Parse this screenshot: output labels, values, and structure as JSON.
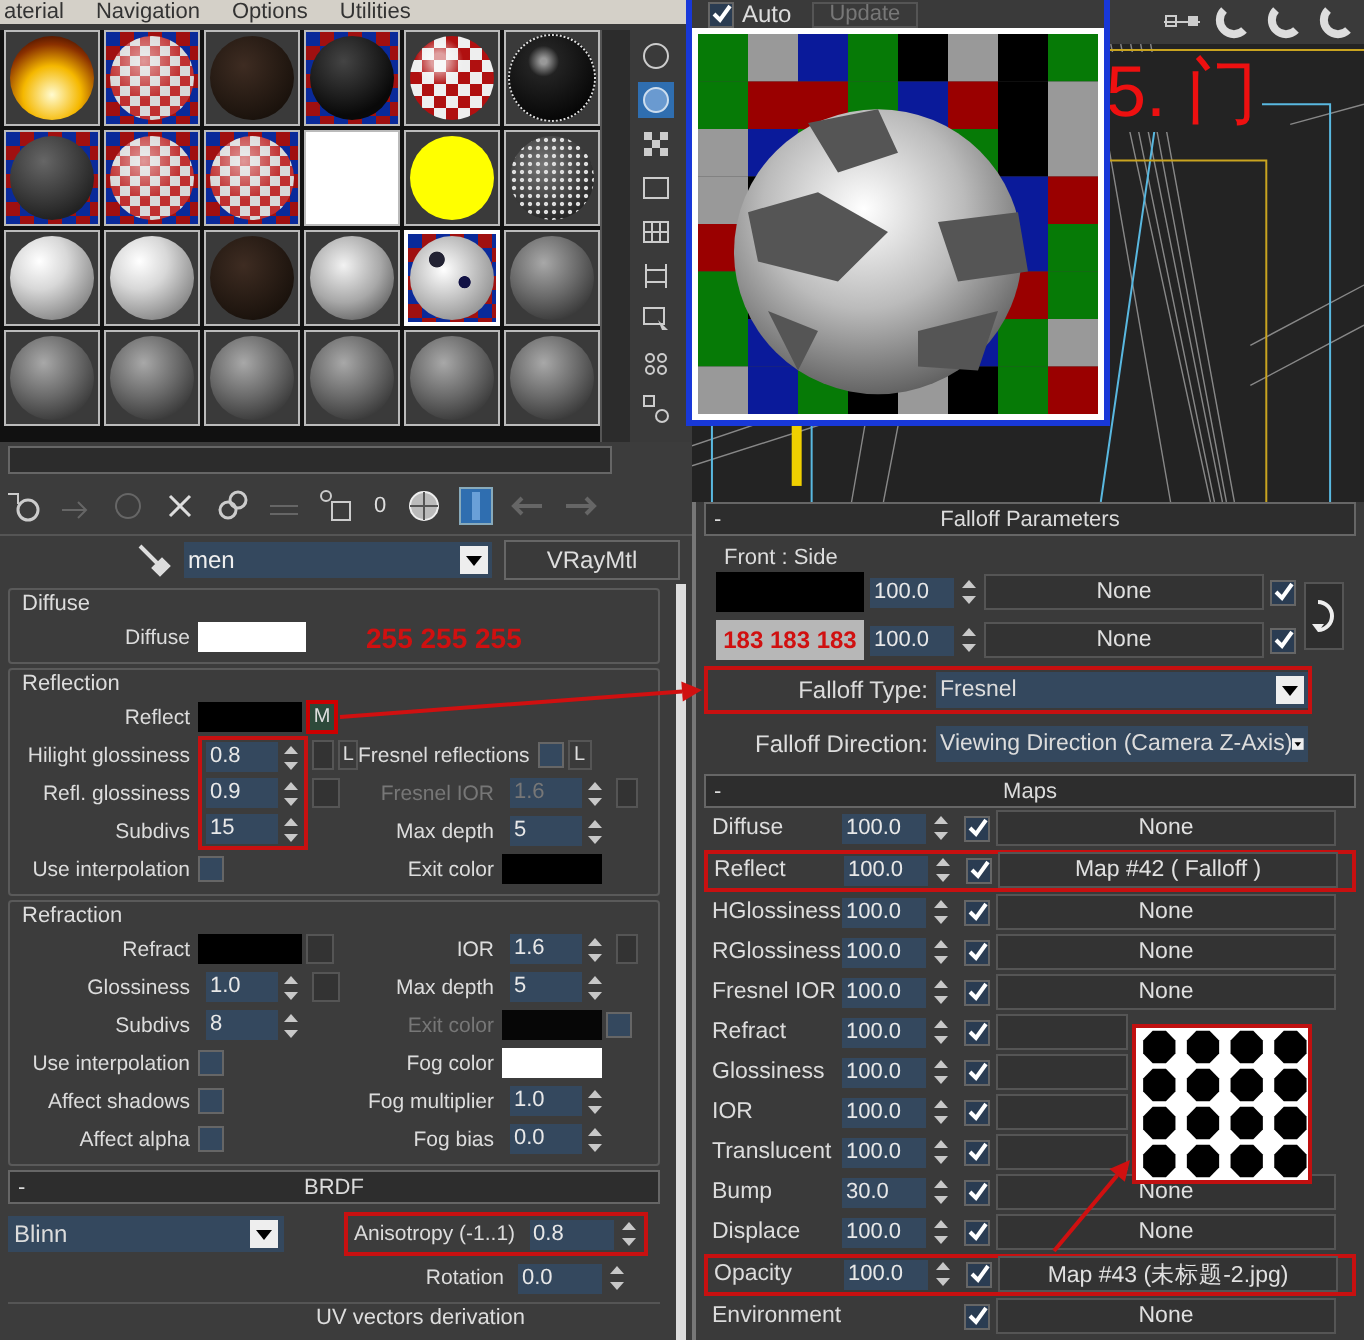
{
  "menu": [
    "aterial",
    "Navigation",
    "Options",
    "Utilities"
  ],
  "sample_slots": [
    {
      "kind": "flame",
      "selected": false
    },
    {
      "kind": "checker",
      "selected": false
    },
    {
      "kind": "brown",
      "selected": false
    },
    {
      "kind": "checker-dark",
      "selected": false
    },
    {
      "kind": "red-checker",
      "selected": false
    },
    {
      "kind": "black",
      "selected": false
    },
    {
      "kind": "checker-gray",
      "selected": false
    },
    {
      "kind": "checker",
      "selected": false
    },
    {
      "kind": "checker",
      "selected": false
    },
    {
      "kind": "white",
      "selected": false
    },
    {
      "kind": "yellow",
      "selected": false
    },
    {
      "kind": "speckled",
      "selected": false
    },
    {
      "kind": "pearl",
      "selected": false
    },
    {
      "kind": "pearl",
      "selected": false
    },
    {
      "kind": "brown",
      "selected": false
    },
    {
      "kind": "silver",
      "selected": false
    },
    {
      "kind": "perforated",
      "selected": true
    },
    {
      "kind": "gray",
      "selected": false
    },
    {
      "kind": "gray",
      "selected": false
    },
    {
      "kind": "gray",
      "selected": false
    },
    {
      "kind": "gray",
      "selected": false
    },
    {
      "kind": "gray",
      "selected": false
    },
    {
      "kind": "gray",
      "selected": false
    },
    {
      "kind": "gray",
      "selected": false
    }
  ],
  "toolbar_id": "0",
  "material": {
    "name": "men",
    "type": "VRayMtl"
  },
  "diffuse": {
    "title": "Diffuse",
    "label": "Diffuse",
    "color": "#ffffff",
    "annotation": "255 255 255"
  },
  "reflection": {
    "title": "Reflection",
    "rows": [
      {
        "left": {
          "kind": "swatch",
          "label": "Reflect",
          "color": "#000000",
          "map_text": "M"
        }
      },
      {
        "left": {
          "kind": "spinner",
          "label": "Hilight glossiness",
          "value": "0.8",
          "highlighted": true,
          "map_button": true,
          "lock": "L"
        },
        "right": {
          "kind": "checkbox",
          "label": "Fresnel reflections",
          "checked": false,
          "lock": "L"
        }
      },
      {
        "left": {
          "kind": "spinner",
          "label": "Refl. glossiness",
          "value": "0.9",
          "highlighted": true,
          "map_button": true
        },
        "right": {
          "kind": "spinner",
          "label": "Fresnel IOR",
          "value": "1.6",
          "disabled": true,
          "map_button": true
        }
      },
      {
        "left": {
          "kind": "spinner",
          "label": "Subdivs",
          "value": "15",
          "highlighted": true
        },
        "right": {
          "kind": "spinner",
          "label": "Max depth",
          "value": "5"
        }
      },
      {
        "left": {
          "kind": "checkbox",
          "label": "Use interpolation",
          "checked": false
        },
        "right": {
          "kind": "swatch",
          "label": "Exit color",
          "color": "#000000"
        }
      }
    ]
  },
  "refraction": {
    "title": "Refraction",
    "rows": [
      {
        "left": {
          "kind": "swatch",
          "label": "Refract",
          "color": "#000000",
          "map_button": true
        },
        "right": {
          "kind": "spinner",
          "label": "IOR",
          "value": "1.6",
          "map_button": true
        }
      },
      {
        "left": {
          "kind": "spinner",
          "label": "Glossiness",
          "value": "1.0",
          "map_button": true
        },
        "right": {
          "kind": "spinner",
          "label": "Max depth",
          "value": "5"
        }
      },
      {
        "left": {
          "kind": "spinner",
          "label": "Subdivs",
          "value": "8"
        },
        "right": {
          "kind": "swatch",
          "label": "Exit color",
          "color": "#000000",
          "disabled": true,
          "check": false
        }
      },
      {
        "left": {
          "kind": "checkbox",
          "label": "Use interpolation",
          "checked": false
        },
        "right": {
          "kind": "swatch",
          "label": "Fog color",
          "color": "#ffffff"
        }
      },
      {
        "left": {
          "kind": "checkbox",
          "label": "Affect shadows",
          "checked": false
        },
        "right": {
          "kind": "spinner",
          "label": "Fog multiplier",
          "value": "1.0"
        }
      },
      {
        "left": {
          "kind": "checkbox",
          "label": "Affect alpha",
          "checked": false
        },
        "right": {
          "kind": "spinner",
          "label": "Fog bias",
          "value": "0.0"
        }
      }
    ]
  },
  "brdf": {
    "sign": "-",
    "title": "BRDF",
    "shader": "Blinn",
    "anisotropy": {
      "label": "Anisotropy (-1..1)",
      "value": "0.8",
      "highlighted": true
    },
    "rotation": {
      "label": "Rotation",
      "value": "0.0"
    },
    "uv_group": "UV vectors derivation"
  },
  "preview": {
    "auto": {
      "label": "Auto",
      "checked": true
    },
    "update": "Update"
  },
  "viewport_label": "5. 门",
  "falloff": {
    "sign": "-",
    "title": "Falloff Parameters",
    "group": "Front : Side",
    "rows": [
      {
        "color": "#000000",
        "value": "100.0",
        "map": "None",
        "checked": true
      },
      {
        "color": "#b7b7b7",
        "value": "100.0",
        "map": "None",
        "checked": true,
        "annotation": "183 183 183"
      }
    ],
    "type": {
      "label": "Falloff Type:",
      "value": "Fresnel",
      "highlighted": true
    },
    "direction": {
      "label": "Falloff Direction:",
      "value": "Viewing Direction (Camera Z-Axis)",
      "highlighted": false
    }
  },
  "maps": {
    "sign": "-",
    "title": "Maps",
    "rows": [
      {
        "label": "Diffuse",
        "value": "100.0",
        "checked": true,
        "map": "None",
        "highlighted": false
      },
      {
        "label": "Reflect",
        "value": "100.0",
        "checked": true,
        "map": "Map #42  ( Falloff )",
        "highlighted": true
      },
      {
        "label": "HGlossiness",
        "value": "100.0",
        "checked": true,
        "map": "None",
        "highlighted": false
      },
      {
        "label": "RGlossiness",
        "value": "100.0",
        "checked": true,
        "map": "None",
        "highlighted": false
      },
      {
        "label": "Fresnel IOR",
        "value": "100.0",
        "checked": true,
        "map": "None",
        "highlighted": false
      },
      {
        "label": "Refract",
        "value": "100.0",
        "checked": true,
        "highlighted": false
      },
      {
        "label": "Glossiness",
        "value": "100.0",
        "checked": true,
        "highlighted": false
      },
      {
        "label": "IOR",
        "value": "100.0",
        "checked": true,
        "highlighted": false
      },
      {
        "label": "Translucent",
        "value": "100.0",
        "checked": true,
        "highlighted": false
      },
      {
        "label": "Bump",
        "value": "30.0",
        "checked": true,
        "map": "None",
        "highlighted": false
      },
      {
        "label": "Displace",
        "value": "100.0",
        "checked": true,
        "map": "None",
        "highlighted": false
      },
      {
        "label": "Opacity",
        "value": "100.0",
        "checked": true,
        "map": "Map #43 (未标题-2.jpg)",
        "highlighted": true
      },
      {
        "label": "Environment",
        "checked": true,
        "map": "None",
        "highlighted": false
      }
    ]
  }
}
